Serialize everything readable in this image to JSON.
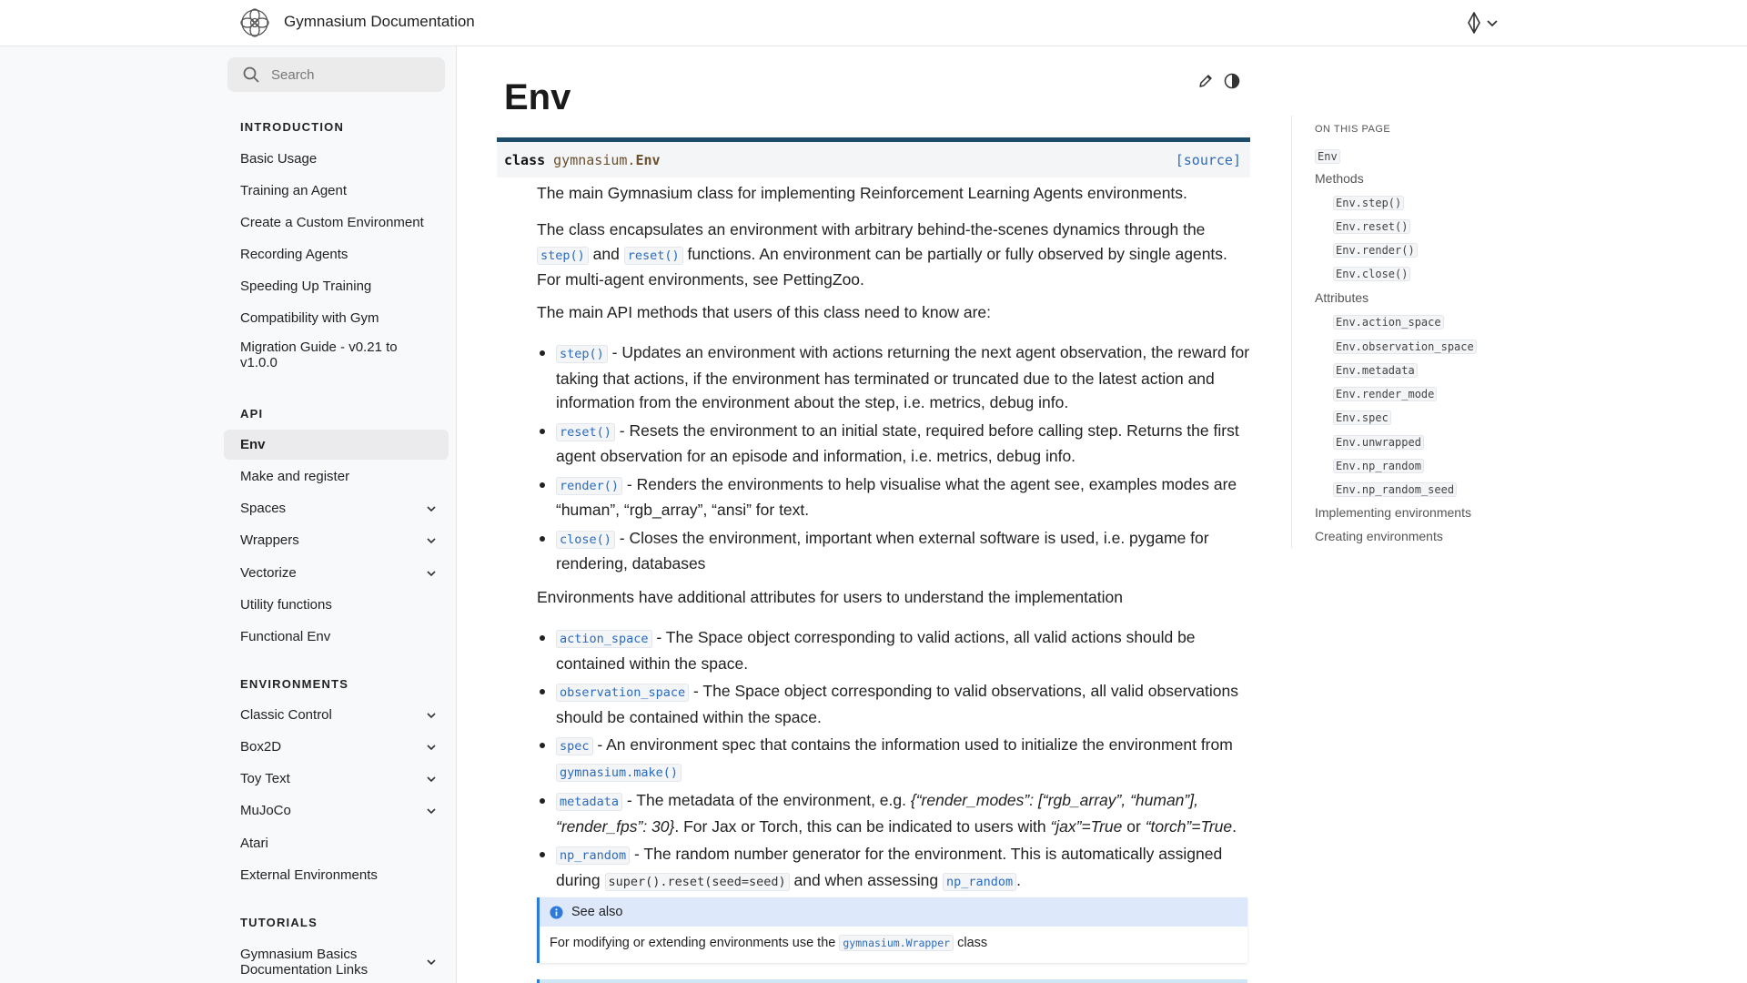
{
  "header": {
    "site_title": "Gymnasium Documentation"
  },
  "sidebar": {
    "search_placeholder": "Search",
    "sections": [
      {
        "caption": "INTRODUCTION",
        "items": [
          {
            "label": "Basic Usage"
          },
          {
            "label": "Training an Agent"
          },
          {
            "label": "Create a Custom Environment"
          },
          {
            "label": "Recording Agents"
          },
          {
            "label": "Speeding Up Training"
          },
          {
            "label": "Compatibility with Gym"
          },
          {
            "label": "Migration Guide - v0.21 to v1.0.0"
          }
        ]
      },
      {
        "caption": "API",
        "items": [
          {
            "label": "Env",
            "active": true
          },
          {
            "label": "Make and register"
          },
          {
            "label": "Spaces",
            "expandable": true
          },
          {
            "label": "Wrappers",
            "expandable": true
          },
          {
            "label": "Vectorize",
            "expandable": true
          },
          {
            "label": "Utility functions"
          },
          {
            "label": "Functional Env"
          }
        ]
      },
      {
        "caption": "ENVIRONMENTS",
        "items": [
          {
            "label": "Classic Control",
            "expandable": true
          },
          {
            "label": "Box2D",
            "expandable": true
          },
          {
            "label": "Toy Text",
            "expandable": true
          },
          {
            "label": "MuJoCo",
            "expandable": true
          },
          {
            "label": "Atari"
          },
          {
            "label": "External Environments"
          }
        ]
      },
      {
        "caption": "TUTORIALS",
        "items": [
          {
            "label": "Gymnasium Basics Documentation Links",
            "expandable": true
          }
        ]
      }
    ]
  },
  "main": {
    "title": "Env",
    "signature": {
      "keyword": "class",
      "module": "gymnasium.",
      "name": "Env",
      "source_link": "[source]"
    },
    "intro": "The main Gymnasium class for implementing Reinforcement Learning Agents environments.",
    "para2": {
      "a": "The class encapsulates an environment with arbitrary behind-the-scenes dynamics through the",
      "code1": "step()",
      "b": "and",
      "code2": "reset()",
      "c": "functions. An environment can be partially or fully observed by single agents. For multi-agent environments, see PettingZoo."
    },
    "para3": "The main API methods that users of this class need to know are:",
    "methods": [
      {
        "code": "step()",
        "text": "- Updates an environment with actions returning the next agent observation, the reward for taking that actions, if the environment has terminated or truncated due to the latest action and information from the environment about the step, i.e. metrics, debug info."
      },
      {
        "code": "reset()",
        "text": "- Resets the environment to an initial state, required before calling step. Returns the first agent observation for an episode and information, i.e. metrics, debug info."
      },
      {
        "code": "render()",
        "text": "- Renders the environments to help visualise what the agent see, examples modes are “human”, “rgb_array”, “ansi” for text."
      },
      {
        "code": "close()",
        "text": "- Closes the environment, important when external software is used, i.e. pygame for rendering, databases"
      }
    ],
    "para4": "Environments have additional attributes for users to understand the implementation",
    "attributes": {
      "action_space": {
        "code": "action_space",
        "text": "- The Space object corresponding to valid actions, all valid actions should be contained within the space."
      },
      "observation_space": {
        "code": "observation_space",
        "text": "- The Space object corresponding to valid observations, all valid observations should be contained within the space."
      },
      "spec": {
        "code": "spec",
        "text": "- An environment spec that contains the information used to initialize the environment from",
        "code2": "gymnasium.make()"
      },
      "metadata": {
        "code": "metadata",
        "text_a": "- The metadata of the environment, e.g.",
        "em1": "{“render_modes”: [“rgb_array”, “human”], “render_fps”: 30}",
        "text_b": ". For Jax or Torch, this can be indicated to users with",
        "em2": "“jax”=True",
        "text_c": "or",
        "em3": "“torch”=True",
        "text_d": "."
      },
      "np_random": {
        "code": "np_random",
        "text_a": "- The random number generator for the environment. This is automatically assigned during",
        "code2": "super().reset(seed=seed)",
        "text_b": "and when assessing",
        "code3": "np_random",
        "text_c": "."
      }
    },
    "see_also": {
      "title": "See also",
      "body_a": "For modifying or extending environments use the",
      "code": "gymnasium.Wrapper",
      "body_b": "class"
    }
  },
  "toc": {
    "caption": "ON THIS PAGE",
    "items": [
      {
        "label": "Env",
        "code": true,
        "level": 1
      },
      {
        "label": "Methods",
        "level": 1
      },
      {
        "label": "Env.step()",
        "code": true,
        "level": 2
      },
      {
        "label": "Env.reset()",
        "code": true,
        "level": 2
      },
      {
        "label": "Env.render()",
        "code": true,
        "level": 2
      },
      {
        "label": "Env.close()",
        "code": true,
        "level": 2
      },
      {
        "label": "Attributes",
        "level": 1
      },
      {
        "label": "Env.action_space",
        "code": true,
        "level": 2
      },
      {
        "label": "Env.observation_space",
        "code": true,
        "level": 2
      },
      {
        "label": "Env.metadata",
        "code": true,
        "level": 2
      },
      {
        "label": "Env.render_mode",
        "code": true,
        "level": 2
      },
      {
        "label": "Env.spec",
        "code": true,
        "level": 2
      },
      {
        "label": "Env.unwrapped",
        "code": true,
        "level": 2
      },
      {
        "label": "Env.np_random",
        "code": true,
        "level": 2
      },
      {
        "label": "Env.np_random_seed",
        "code": true,
        "level": 2
      },
      {
        "label": "Implementing environments",
        "level": 1
      },
      {
        "label": "Creating environments",
        "level": 1
      }
    ]
  },
  "colors": {
    "link": "#2a6bbf",
    "signature_border": "#1e4d6b",
    "admonition_accent": "#2d7ad8",
    "admonition_header": "#dde8fb",
    "sidebar_bg": "#f8f9fb"
  }
}
